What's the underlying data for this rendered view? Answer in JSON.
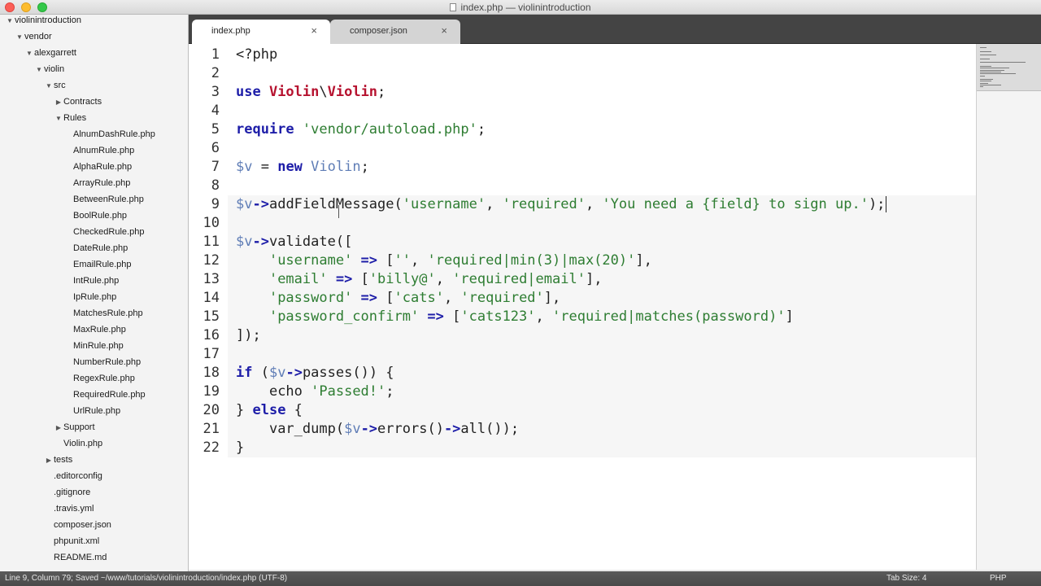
{
  "window": {
    "title": "index.php — violinintroduction"
  },
  "sidebar": {
    "items": [
      {
        "label": "violinintroduction",
        "depth": 0,
        "arrow": "▼"
      },
      {
        "label": "vendor",
        "depth": 1,
        "arrow": "▼"
      },
      {
        "label": "alexgarrett",
        "depth": 2,
        "arrow": "▼"
      },
      {
        "label": "violin",
        "depth": 3,
        "arrow": "▼"
      },
      {
        "label": "src",
        "depth": 4,
        "arrow": "▼"
      },
      {
        "label": "Contracts",
        "depth": 5,
        "arrow": "▶"
      },
      {
        "label": "Rules",
        "depth": 5,
        "arrow": "▼"
      },
      {
        "label": "AlnumDashRule.php",
        "depth": 6,
        "arrow": ""
      },
      {
        "label": "AlnumRule.php",
        "depth": 6,
        "arrow": ""
      },
      {
        "label": "AlphaRule.php",
        "depth": 6,
        "arrow": ""
      },
      {
        "label": "ArrayRule.php",
        "depth": 6,
        "arrow": ""
      },
      {
        "label": "BetweenRule.php",
        "depth": 6,
        "arrow": ""
      },
      {
        "label": "BoolRule.php",
        "depth": 6,
        "arrow": ""
      },
      {
        "label": "CheckedRule.php",
        "depth": 6,
        "arrow": ""
      },
      {
        "label": "DateRule.php",
        "depth": 6,
        "arrow": ""
      },
      {
        "label": "EmailRule.php",
        "depth": 6,
        "arrow": ""
      },
      {
        "label": "IntRule.php",
        "depth": 6,
        "arrow": ""
      },
      {
        "label": "IpRule.php",
        "depth": 6,
        "arrow": ""
      },
      {
        "label": "MatchesRule.php",
        "depth": 6,
        "arrow": ""
      },
      {
        "label": "MaxRule.php",
        "depth": 6,
        "arrow": ""
      },
      {
        "label": "MinRule.php",
        "depth": 6,
        "arrow": ""
      },
      {
        "label": "NumberRule.php",
        "depth": 6,
        "arrow": ""
      },
      {
        "label": "RegexRule.php",
        "depth": 6,
        "arrow": ""
      },
      {
        "label": "RequiredRule.php",
        "depth": 6,
        "arrow": ""
      },
      {
        "label": "UrlRule.php",
        "depth": 6,
        "arrow": ""
      },
      {
        "label": "Support",
        "depth": 5,
        "arrow": "▶"
      },
      {
        "label": "Violin.php",
        "depth": 5,
        "arrow": ""
      },
      {
        "label": "tests",
        "depth": 4,
        "arrow": "▶"
      },
      {
        "label": ".editorconfig",
        "depth": 4,
        "arrow": ""
      },
      {
        "label": ".gitignore",
        "depth": 4,
        "arrow": ""
      },
      {
        "label": ".travis.yml",
        "depth": 4,
        "arrow": ""
      },
      {
        "label": "composer.json",
        "depth": 4,
        "arrow": ""
      },
      {
        "label": "phpunit.xml",
        "depth": 4,
        "arrow": ""
      },
      {
        "label": "README.md",
        "depth": 4,
        "arrow": ""
      }
    ]
  },
  "tabs": [
    {
      "label": "index.php",
      "close": "×",
      "active": true
    },
    {
      "label": "composer.json",
      "close": "×",
      "active": false
    }
  ],
  "editor": {
    "current_line": 9,
    "lines": [
      [
        [
          "plain",
          "<?php"
        ]
      ],
      [],
      [
        [
          "kw",
          "use "
        ],
        [
          "cls",
          "Violin"
        ],
        [
          "plain",
          "\\"
        ],
        [
          "cls",
          "Violin"
        ],
        [
          "plain",
          ";"
        ]
      ],
      [],
      [
        [
          "kw",
          "require "
        ],
        [
          "str",
          "'vendor/autoload.php'"
        ],
        [
          "plain",
          ";"
        ]
      ],
      [],
      [
        [
          "var",
          "$v"
        ],
        [
          "plain",
          " = "
        ],
        [
          "kw",
          "new "
        ],
        [
          "var",
          "Violin"
        ],
        [
          "plain",
          ";"
        ]
      ],
      [],
      [
        [
          "var",
          "$v"
        ],
        [
          "op",
          "->"
        ],
        [
          "fn",
          "addFieldMessage("
        ],
        [
          "str",
          "'username'"
        ],
        [
          "plain",
          ", "
        ],
        [
          "str",
          "'required'"
        ],
        [
          "plain",
          ", "
        ],
        [
          "str",
          "'You need a {field} to sign up.'"
        ],
        [
          "plain",
          ");"
        ]
      ],
      [],
      [
        [
          "var",
          "$v"
        ],
        [
          "op",
          "->"
        ],
        [
          "fn",
          "validate(["
        ]
      ],
      [
        [
          "plain",
          "    "
        ],
        [
          "str",
          "'username'"
        ],
        [
          "op",
          " => "
        ],
        [
          "plain",
          "["
        ],
        [
          "str",
          "''"
        ],
        [
          "plain",
          ", "
        ],
        [
          "str",
          "'required|min(3)|max(20)'"
        ],
        [
          "plain",
          "],"
        ]
      ],
      [
        [
          "plain",
          "    "
        ],
        [
          "str",
          "'email'"
        ],
        [
          "op",
          " => "
        ],
        [
          "plain",
          "["
        ],
        [
          "str",
          "'billy@'"
        ],
        [
          "plain",
          ", "
        ],
        [
          "str",
          "'required|email'"
        ],
        [
          "plain",
          "],"
        ]
      ],
      [
        [
          "plain",
          "    "
        ],
        [
          "str",
          "'password'"
        ],
        [
          "op",
          " => "
        ],
        [
          "plain",
          "["
        ],
        [
          "str",
          "'cats'"
        ],
        [
          "plain",
          ", "
        ],
        [
          "str",
          "'required'"
        ],
        [
          "plain",
          "],"
        ]
      ],
      [
        [
          "plain",
          "    "
        ],
        [
          "str",
          "'password_confirm'"
        ],
        [
          "op",
          " => "
        ],
        [
          "plain",
          "["
        ],
        [
          "str",
          "'cats123'"
        ],
        [
          "plain",
          ", "
        ],
        [
          "str",
          "'required|matches(password)'"
        ],
        [
          "plain",
          "]"
        ]
      ],
      [
        [
          "plain",
          "]);"
        ]
      ],
      [],
      [
        [
          "kw",
          "if "
        ],
        [
          "plain",
          "("
        ],
        [
          "var",
          "$v"
        ],
        [
          "op",
          "->"
        ],
        [
          "fn",
          "passes()) {"
        ]
      ],
      [
        [
          "plain",
          "    "
        ],
        [
          "fn",
          "echo "
        ],
        [
          "str",
          "'Passed!'"
        ],
        [
          "plain",
          ";"
        ]
      ],
      [
        [
          "plain",
          "} "
        ],
        [
          "kw",
          "else "
        ],
        [
          "plain",
          "{"
        ]
      ],
      [
        [
          "plain",
          "    "
        ],
        [
          "fn",
          "var_dump("
        ],
        [
          "var",
          "$v"
        ],
        [
          "op",
          "->"
        ],
        [
          "fn",
          "errors()"
        ],
        [
          "op",
          "->"
        ],
        [
          "fn",
          "all());"
        ]
      ],
      [
        [
          "plain",
          "}"
        ]
      ]
    ]
  },
  "status": {
    "text": "Line 9, Column 79; Saved ~/www/tutorials/violinintroduction/index.php (UTF-8)",
    "tab_size": "Tab Size: 4",
    "syntax": "PHP"
  }
}
